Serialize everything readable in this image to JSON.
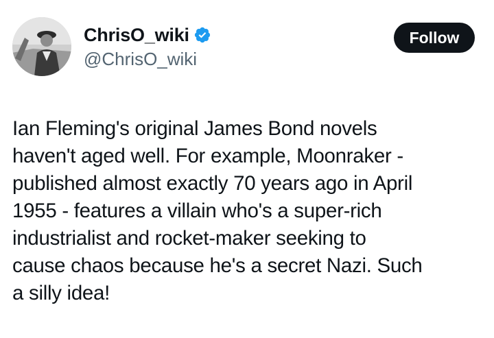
{
  "author": {
    "display_name": "ChrisO_wiki",
    "handle": "@ChrisO_wiki",
    "verified": true,
    "verified_color": "#1d9bf0"
  },
  "actions": {
    "follow_label": "Follow"
  },
  "tweet": {
    "lines": [
      "Ian Fleming's original James Bond novels",
      "haven't aged well. For example, Moonraker -",
      "published almost exactly 70 years ago in April",
      "1955 - features a villain who's a super-rich",
      "industrialist and rocket-maker seeking to",
      "cause chaos because he's a secret Nazi. Such",
      "a silly idea!"
    ]
  },
  "icons": {
    "avatar": "avatar-photo",
    "verified": "verified-badge-icon"
  }
}
